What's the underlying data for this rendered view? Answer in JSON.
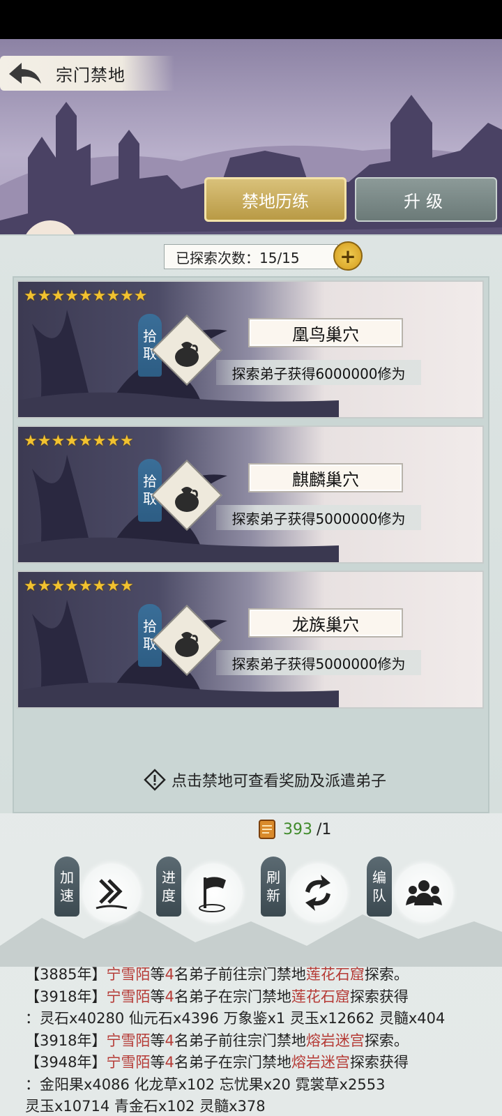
{
  "header": {
    "title": "宗门禁地"
  },
  "tabs": [
    {
      "label": "禁地历练",
      "active": true
    },
    {
      "label": "升级",
      "active": false
    }
  ],
  "counter": {
    "label": "已探索次数：15/15",
    "plus": "+"
  },
  "cards": [
    {
      "stars": "★★★★★★★★★",
      "star_count": 9,
      "tag": [
        "拾",
        "取"
      ],
      "name": "凰鸟巢穴",
      "reward": "探索弟子获得6000000修为"
    },
    {
      "stars": "★★★★★★★★",
      "star_count": 8,
      "tag": [
        "拾",
        "取"
      ],
      "name": "麒麟巢穴",
      "reward": "探索弟子获得5000000修为"
    },
    {
      "stars": "★★★★★★★★",
      "star_count": 8,
      "tag": [
        "拾",
        "取"
      ],
      "name": "龙族巢穴",
      "reward": "探索弟子获得5000000修为"
    }
  ],
  "tip": "点击禁地可查看奖励及派遣弟子",
  "scroll_count": {
    "value": "393",
    "max": "/1"
  },
  "actions": [
    {
      "label": [
        "加",
        "速"
      ],
      "icon": "fast-forward-icon"
    },
    {
      "label": [
        "进",
        "度"
      ],
      "icon": "flag-icon"
    },
    {
      "label": [
        "刷",
        "新"
      ],
      "icon": "refresh-icon"
    },
    {
      "label": [
        "编",
        "队"
      ],
      "icon": "team-icon"
    }
  ],
  "log": [
    {
      "parts": [
        [
          "【3885年】",
          ""
        ],
        [
          "宁雪陌",
          "hl"
        ],
        [
          "等",
          ""
        ],
        [
          "4",
          "hl"
        ],
        [
          "名弟子前往宗门禁地",
          ""
        ],
        [
          "莲花石窟",
          "hl"
        ],
        [
          "探索。",
          ""
        ]
      ]
    },
    {
      "parts": [
        [
          "【3918年】",
          ""
        ],
        [
          "宁雪陌",
          "hl"
        ],
        [
          "等",
          ""
        ],
        [
          "4",
          "hl"
        ],
        [
          "名弟子在宗门禁地",
          ""
        ],
        [
          "莲花石窟",
          "hl"
        ],
        [
          "探索获得",
          ""
        ]
      ]
    },
    {
      "parts": [
        [
          "：灵石x40280 仙元石x4396 万象鉴x1 灵玉x12662 灵髓x404",
          ""
        ]
      ]
    },
    {
      "parts": [
        [
          "【3918年】",
          ""
        ],
        [
          "宁雪陌",
          "hl"
        ],
        [
          "等",
          ""
        ],
        [
          "4",
          "hl"
        ],
        [
          "名弟子前往宗门禁地",
          ""
        ],
        [
          "熔岩迷宫",
          "hl"
        ],
        [
          "探索。",
          ""
        ]
      ]
    },
    {
      "parts": [
        [
          "【3948年】",
          ""
        ],
        [
          "宁雪陌",
          "hl"
        ],
        [
          "等",
          ""
        ],
        [
          "4",
          "hl"
        ],
        [
          "名弟子在宗门禁地",
          ""
        ],
        [
          "熔岩迷宫",
          "hl"
        ],
        [
          "探索获得",
          ""
        ]
      ]
    },
    {
      "parts": [
        [
          "：金阳果x4086 化龙草x102 忘忧果x20 霓裳草x2553",
          ""
        ]
      ]
    },
    {
      "parts": [
        [
          "灵玉x10714 青金石x102 灵髓x378",
          ""
        ]
      ]
    }
  ],
  "colors": {
    "highlight": "#b53a35",
    "count_green": "#3f8a2a",
    "tab_gold": "#c9ad5a"
  }
}
